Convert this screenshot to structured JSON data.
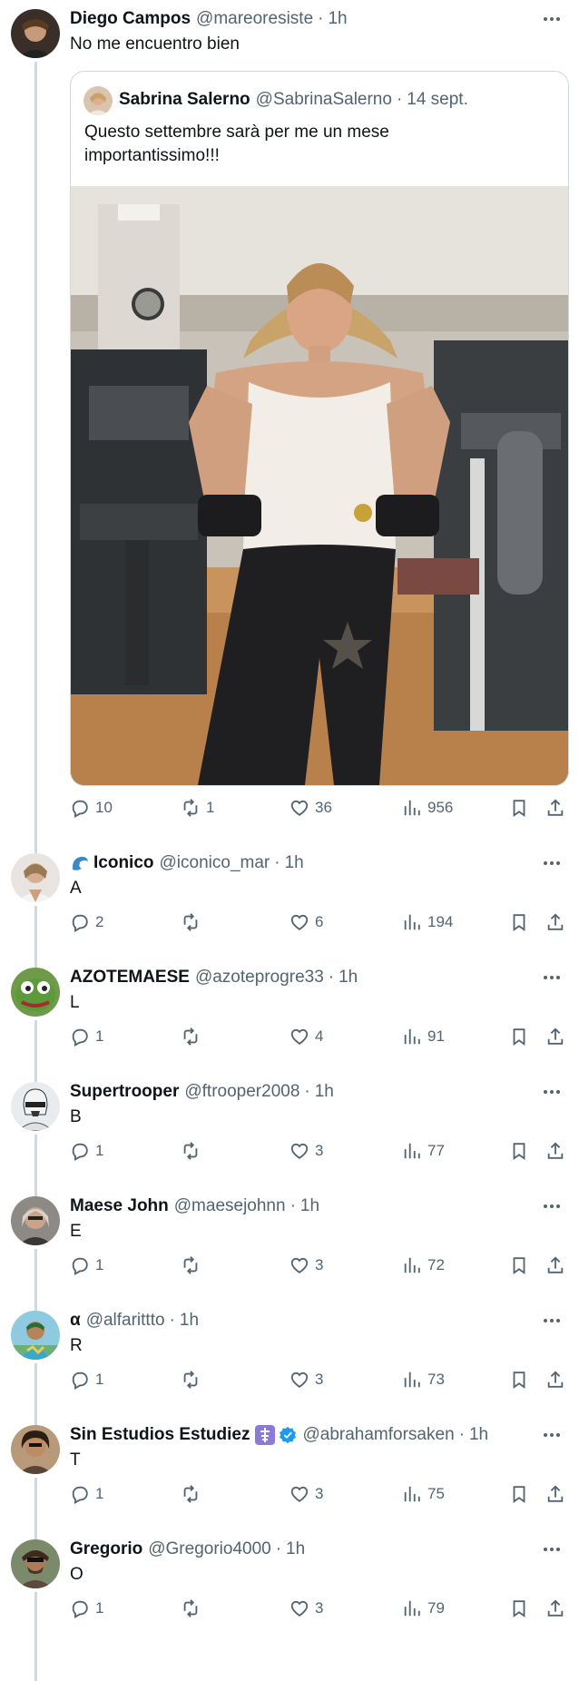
{
  "main_tweet": {
    "name": "Diego Campos",
    "handle": "@mareoresiste",
    "time": "1h",
    "text": "No me encuentro bien",
    "quote": {
      "name": "Sabrina Salerno",
      "handle": "@SabrinaSalerno",
      "time": "14 sept.",
      "text": "Questo settembre sarà per me un mese importantissimo!!!",
      "image": "photo-woman-gym"
    },
    "replies": "10",
    "reposts": "1",
    "likes": "36",
    "views": "956"
  },
  "replies": [
    {
      "name": "Iconico",
      "handle": "@iconico_mar",
      "time": "1h",
      "text": "A",
      "replies": "2",
      "reposts": "",
      "likes": "6",
      "views": "194",
      "badge": "wave-emoji"
    },
    {
      "name": "AZOTEMAESE",
      "handle": "@azoteprogre33",
      "time": "1h",
      "text": "L",
      "replies": "1",
      "reposts": "",
      "likes": "4",
      "views": "91"
    },
    {
      "name": "Supertrooper",
      "handle": "@ftrooper2008",
      "time": "1h",
      "text": "B",
      "replies": "1",
      "reposts": "",
      "likes": "3",
      "views": "77"
    },
    {
      "name": "Maese John",
      "handle": "@maesejohnn",
      "time": "1h",
      "text": "E",
      "replies": "1",
      "reposts": "",
      "likes": "3",
      "views": "72"
    },
    {
      "name": "α",
      "handle": "@alfarittto",
      "time": "1h",
      "text": "R",
      "replies": "1",
      "reposts": "",
      "likes": "3",
      "views": "73"
    },
    {
      "name": "Sin Estudios Estudiez",
      "handle": "@abrahamforsaken",
      "time": "1h",
      "text": "T",
      "replies": "1",
      "reposts": "",
      "likes": "3",
      "views": "75",
      "badge": "cross-and-verified"
    },
    {
      "name": "Gregorio",
      "handle": "@Gregorio4000",
      "time": "1h",
      "text": "O",
      "replies": "1",
      "reposts": "",
      "likes": "3",
      "views": "79"
    }
  ],
  "dot": "·",
  "colors": {
    "text": "#0f1419",
    "secondary": "#536471",
    "border": "#cfd9de",
    "verified": "#1d9bf0"
  }
}
